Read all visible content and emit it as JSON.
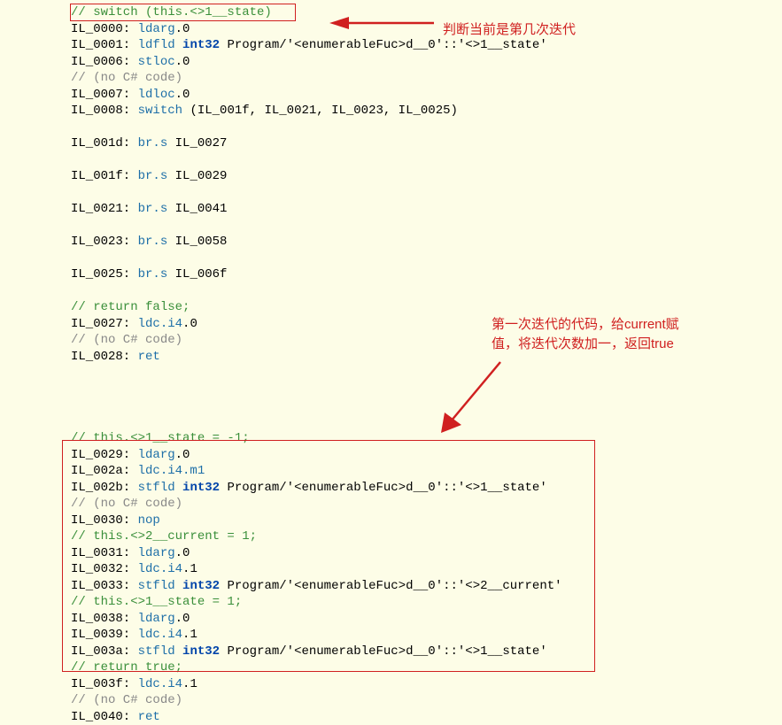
{
  "annot": {
    "a1": "判断当前是第几次迭代",
    "a2_l1": "第一次迭代的代码，给current赋",
    "a2_l2": "值，将迭代次数加一，返回true"
  },
  "code": [
    {
      "type": "cg",
      "text": "// switch (this.<>1__state)"
    },
    {
      "type": "il",
      "label": "IL_0000",
      "op": "ldarg",
      "rest": ".0"
    },
    {
      "type": "il",
      "label": "IL_0001",
      "op": "ldfld",
      "kw": " int32",
      "rest": " Program/'<enumerableFuc>d__0'::'<>1__state'"
    },
    {
      "type": "il",
      "label": "IL_0006",
      "op": "stloc",
      "rest": ".0"
    },
    {
      "type": "c",
      "text": "// (no C# code)"
    },
    {
      "type": "il",
      "label": "IL_0007",
      "op": "ldloc",
      "rest": ".0"
    },
    {
      "type": "il",
      "label": "IL_0008",
      "op": "switch",
      "rest": " (IL_001f, IL_0021, IL_0023, IL_0025)"
    },
    {
      "type": "blank"
    },
    {
      "type": "il",
      "label": "IL_001d",
      "op": "br.s",
      "rest": " IL_0027"
    },
    {
      "type": "blank"
    },
    {
      "type": "il",
      "label": "IL_001f",
      "op": "br.s",
      "rest": " IL_0029"
    },
    {
      "type": "blank"
    },
    {
      "type": "il",
      "label": "IL_0021",
      "op": "br.s",
      "rest": " IL_0041"
    },
    {
      "type": "blank"
    },
    {
      "type": "il",
      "label": "IL_0023",
      "op": "br.s",
      "rest": " IL_0058"
    },
    {
      "type": "blank"
    },
    {
      "type": "il",
      "label": "IL_0025",
      "op": "br.s",
      "rest": " IL_006f"
    },
    {
      "type": "blank"
    },
    {
      "type": "cg",
      "text": "// return false;"
    },
    {
      "type": "il",
      "label": "IL_0027",
      "op": "ldc.i4",
      "rest": ".0"
    },
    {
      "type": "c",
      "text": "// (no C# code)"
    },
    {
      "type": "il",
      "label": "IL_0028",
      "op": "ret",
      "rest": ""
    },
    {
      "type": "blank"
    },
    {
      "type": "blank"
    },
    {
      "type": "blank"
    },
    {
      "type": "blank"
    },
    {
      "type": "cg",
      "text": "// this.<>1__state = -1;"
    },
    {
      "type": "il",
      "label": "IL_0029",
      "op": "ldarg",
      "rest": ".0"
    },
    {
      "type": "il",
      "label": "IL_002a",
      "op": "ldc.i4.m1",
      "rest": ""
    },
    {
      "type": "il",
      "label": "IL_002b",
      "op": "stfld",
      "kw": " int32",
      "rest": " Program/'<enumerableFuc>d__0'::'<>1__state'"
    },
    {
      "type": "c",
      "text": "// (no C# code)"
    },
    {
      "type": "il",
      "label": "IL_0030",
      "op": "nop",
      "rest": ""
    },
    {
      "type": "cg",
      "text": "// this.<>2__current = 1;"
    },
    {
      "type": "il",
      "label": "IL_0031",
      "op": "ldarg",
      "rest": ".0"
    },
    {
      "type": "il",
      "label": "IL_0032",
      "op": "ldc.i4",
      "rest": ".1"
    },
    {
      "type": "il",
      "label": "IL_0033",
      "op": "stfld",
      "kw": " int32",
      "rest": " Program/'<enumerableFuc>d__0'::'<>2__current'"
    },
    {
      "type": "cg",
      "text": "// this.<>1__state = 1;"
    },
    {
      "type": "il",
      "label": "IL_0038",
      "op": "ldarg",
      "rest": ".0"
    },
    {
      "type": "il",
      "label": "IL_0039",
      "op": "ldc.i4",
      "rest": ".1"
    },
    {
      "type": "il",
      "label": "IL_003a",
      "op": "stfld",
      "kw": " int32",
      "rest": " Program/'<enumerableFuc>d__0'::'<>1__state'"
    },
    {
      "type": "cg",
      "text": "// return true;"
    },
    {
      "type": "il",
      "label": "IL_003f",
      "op": "ldc.i4",
      "rest": ".1"
    },
    {
      "type": "c",
      "text": "// (no C# code)"
    },
    {
      "type": "il",
      "label": "IL_0040",
      "op": "ret",
      "rest": ""
    }
  ]
}
